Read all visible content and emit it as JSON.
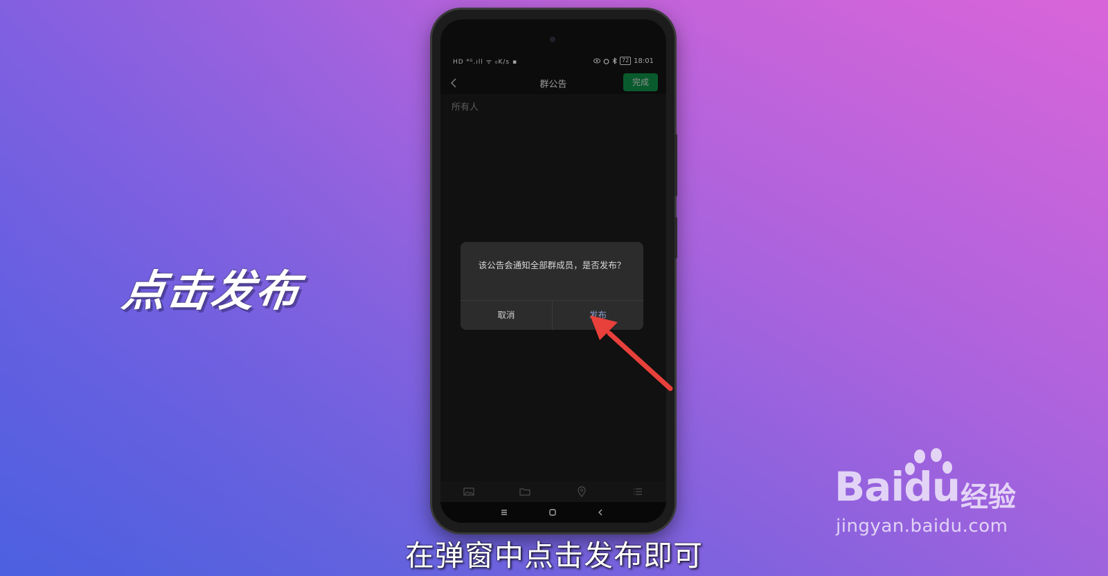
{
  "overlay_title": "点击发布",
  "subtitle": "在弹窗中点击发布即可",
  "phone": {
    "status_bar": {
      "left": "HD ⁴ᴳ.ıll ᯤ ₀K/s ▪",
      "time": "18:01",
      "battery": "72"
    },
    "nav": {
      "title": "群公告",
      "done_label": "完成"
    },
    "editor": {
      "content": "所有人"
    },
    "dialog": {
      "message": "该公告会通知全部群成员，是否发布？",
      "cancel_label": "取消",
      "publish_label": "发布"
    },
    "toolbar": {
      "icons": [
        "image-icon",
        "folder-icon",
        "location-icon",
        "list-icon"
      ]
    },
    "system_nav": [
      "menu-icon",
      "home-icon",
      "back-icon"
    ]
  },
  "watermark": {
    "brand": "Bai",
    "brand_du": "du",
    "cn": "经验",
    "url": "jingyan.baidu.com"
  },
  "colors": {
    "done_button": "#0c7a3c",
    "publish_text": "#8e9fd0",
    "arrow": "#e8403a"
  }
}
